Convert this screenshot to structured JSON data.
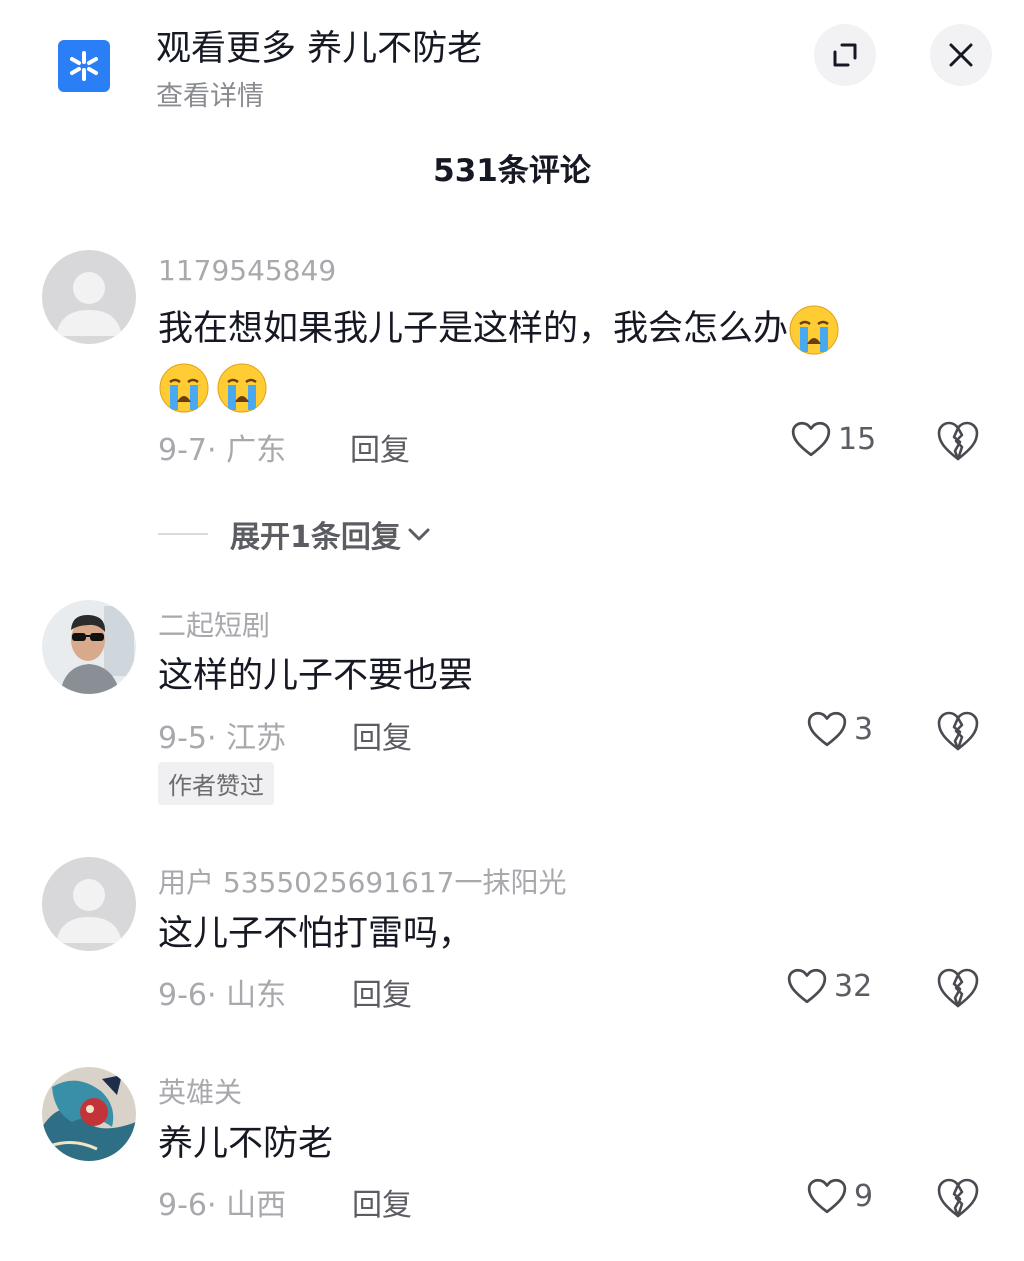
{
  "header": {
    "title": "观看更多 养儿不防老",
    "subtitle": "查看详情",
    "logo_icon": "asterisk-logo-icon",
    "buttons": [
      "collapse-icon",
      "close-icon"
    ]
  },
  "comments_title": "531条评论",
  "comments": [
    {
      "user": "1179545849",
      "text_line1": "我在想如果我儿子是这样的，我会怎么办",
      "emoji": "crying-face",
      "date_location": "9-7· 广东",
      "reply_label": "回复",
      "likes": "15"
    },
    {
      "user": "二起短剧",
      "text": "这样的儿子不要也罢",
      "date_location": "9-5· 江苏",
      "reply_label": "回复",
      "likes": "3",
      "badge": "作者赞过"
    },
    {
      "user": "用户 5355025691617一抹阳光",
      "text": "这儿子不怕打雷吗，",
      "date_location": "9-6· 山东",
      "reply_label": "回复",
      "likes": "32"
    },
    {
      "user": "英雄关",
      "text": "养儿不防老",
      "date_location": "9-6· 山西",
      "reply_label": "回复",
      "likes": "9"
    }
  ],
  "expand_replies": "展开1条回复",
  "colors": {
    "accent_blue": "#2b7ff6",
    "text": "#161823",
    "muted": "#a8a9ad"
  }
}
